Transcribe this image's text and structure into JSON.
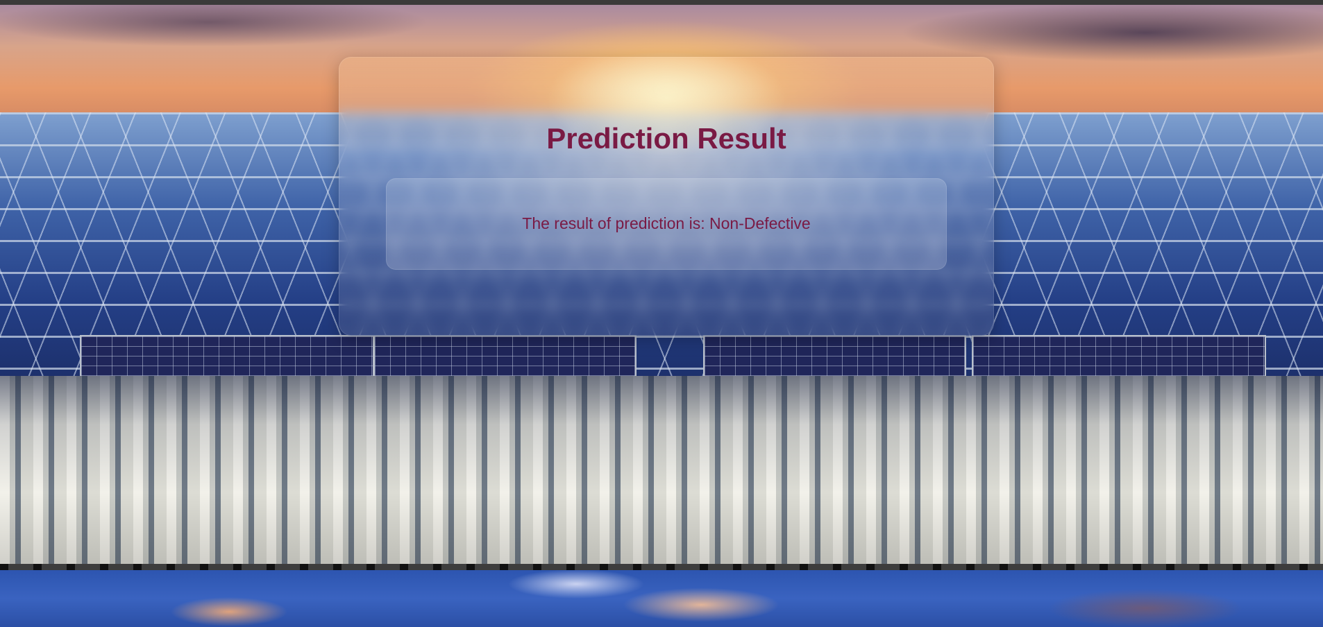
{
  "page": {
    "title": "Prediction Result",
    "result_label": "The result of prediction is: Non-Defective"
  },
  "colors": {
    "accent_text": "#7a1a44",
    "top_bar": "#3a3a3a"
  },
  "background": {
    "description_icon": "solar-roof-sunset-image"
  }
}
